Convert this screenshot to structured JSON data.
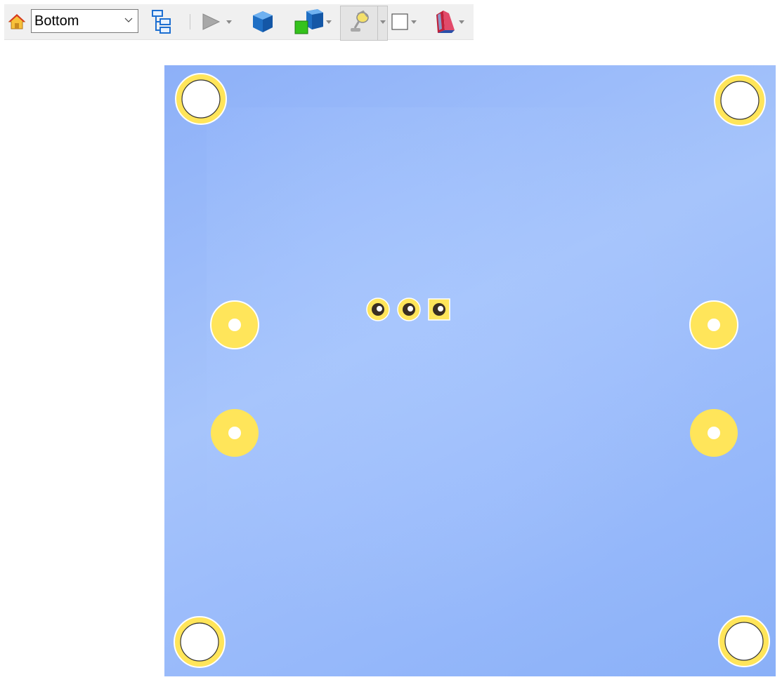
{
  "toolbar": {
    "view_select": {
      "value": "Bottom"
    },
    "icons": {
      "home": "home-icon",
      "tree": "tree-hierarchy-icon",
      "play": "play-icon",
      "cube": "cube-icon",
      "boxes": "boxes-icon",
      "light": "lamp-icon",
      "frame": "frame-icon",
      "material": "material-icon"
    }
  },
  "colors": {
    "board": "#9dbdfb",
    "pad": "#ffe55a",
    "pad_outline": "#ffffff",
    "hole": "#ffffff",
    "drill": "#3a2e22"
  },
  "viewport": {
    "mounting_holes": 4,
    "side_pads": 4,
    "header_pins": 3
  }
}
